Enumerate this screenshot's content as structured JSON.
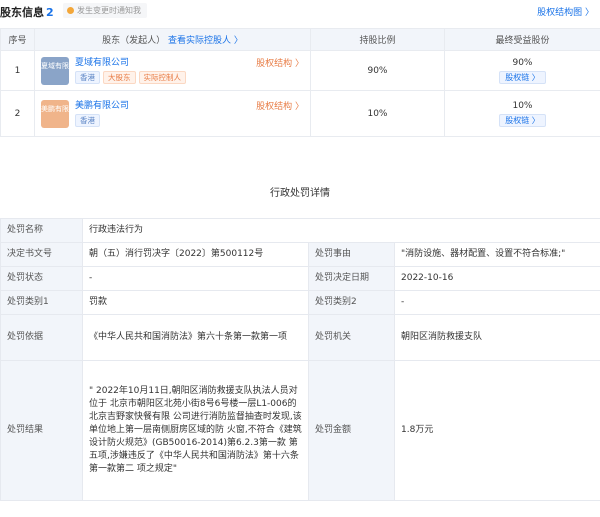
{
  "header": {
    "title": "股东信息",
    "count": "2",
    "notice": "发生变更时通知我",
    "structure_link": "股权结构图 〉"
  },
  "table": {
    "col_index": "序号",
    "col_holder": "股东（发起人）",
    "col_holder_link": "查看实际控股人 〉",
    "col_ratio": "持股比例",
    "col_final": "最终受益股份",
    "rows": [
      {
        "index": "1",
        "logo_text": "夏域有限",
        "name": "夏域有限公司",
        "tags": [
          "香港",
          "大股东",
          "实际控制人"
        ],
        "structure": "股权结构 〉",
        "ratio": "90%",
        "final_ratio": "90%",
        "chain": "股权链 〉"
      },
      {
        "index": "2",
        "logo_text": "美鹏有限",
        "name": "美鹏有限公司",
        "tags": [
          "香港"
        ],
        "structure": "股权结构 〉",
        "ratio": "10%",
        "final_ratio": "10%",
        "chain": "股权链 〉"
      }
    ]
  },
  "penalty": {
    "title": "行政处罚详情",
    "name_label": "处罚名称",
    "name_value": "行政违法行为",
    "doc_label": "决定书文号",
    "doc_value": "朝（五）消行罚决字〔2022〕第500112号",
    "reason_label": "处罚事由",
    "reason_value": "\"消防设施、器材配置、设置不符合标准;\"",
    "status_label": "处罚状态",
    "status_value": "-",
    "date_label": "处罚决定日期",
    "date_value": "2022-10-16",
    "type1_label": "处罚类别1",
    "type1_value": "罚款",
    "type2_label": "处罚类别2",
    "type2_value": "-",
    "basis_label": "处罚依据",
    "basis_value": "《中华人民共和国消防法》第六十条第一款第一项",
    "authority_label": "处罚机关",
    "authority_value": "朝阳区消防救援支队",
    "result_label": "处罚结果",
    "result_value": "\" 2022年10月11日,朝阳区消防救援支队执法人员对位于 北京市朝阳区北苑小街8号6号楼一层L1-006的北京吉野家快餐有限 公司进行消防监督抽查时发现,该单位地上第一层南侧厨房区域的防 火窗,不符合《建筑设计防火规范》(GB50016-2014)第6.2.3第一款 第五项,涉嫌违反了《中华人民共和国消防法》第十六条第一款第二 项之规定\"",
    "amount_label": "处罚金额",
    "amount_value": "1.8万元"
  },
  "colors": {
    "accent_blue": "#1a73e8",
    "orange": "#e87c45",
    "header_bg": "#f2f5fa"
  }
}
